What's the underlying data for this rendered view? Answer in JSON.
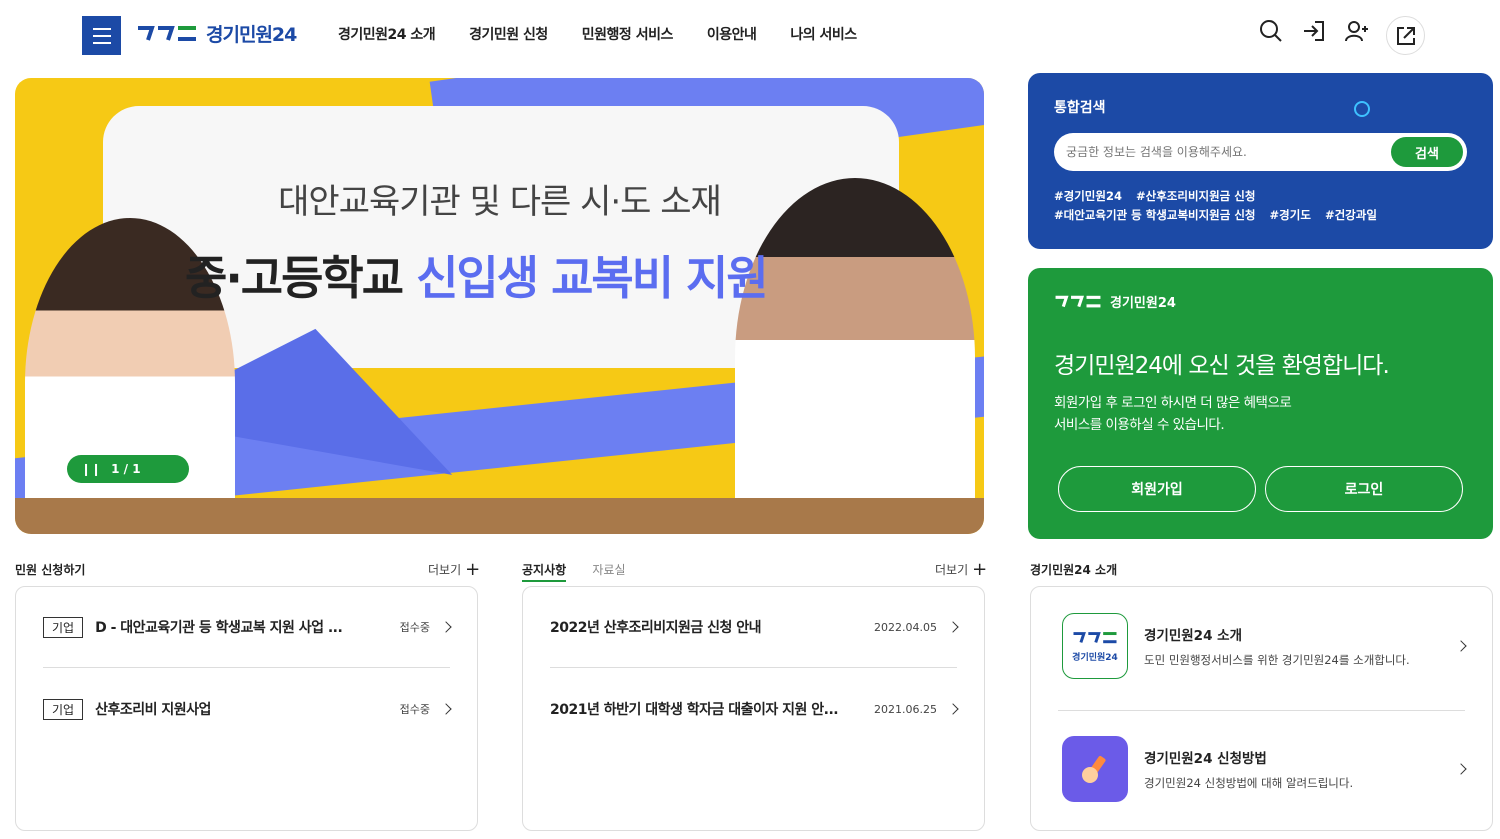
{
  "header": {
    "logo_text": "경기민원24",
    "nav": [
      "경기민원24 소개",
      "경기민원 신청",
      "민원행정 서비스",
      "이용안내",
      "나의 서비스"
    ]
  },
  "banner": {
    "line1": "대안교육기관 및 다른 시·도 소재",
    "line2_a": "중·고등학교",
    "line2_b": "신입생 교복비 지원",
    "pager": "1 / 1"
  },
  "search": {
    "title": "통합검색",
    "placeholder": "궁금한 정보는 검색을 이용해주세요.",
    "button": "검색",
    "tags": [
      "#경기민원24",
      "#산후조리비지원금 신청",
      "#대안교육기관 등 학생교복비지원금 신청",
      "#경기도",
      "#건강과일"
    ]
  },
  "welcome": {
    "logo_text": "경기민원24",
    "title": "경기민원24에 오신 것을 환영합니다.",
    "desc1": "회원가입 후 로그인 하시면 더 많은 혜택으로",
    "desc2": "서비스를 이용하실 수 있습니다.",
    "join": "회원가입",
    "login": "로그인"
  },
  "apply": {
    "title": "민원 신청하기",
    "more": "더보기",
    "items": [
      {
        "badge": "기업",
        "title": "D - 대안교육기관 등 학생교복 지원 사업 ...",
        "status": "접수중"
      },
      {
        "badge": "기업",
        "title": "산후조리비 지원사업",
        "status": "접수중"
      }
    ]
  },
  "notice": {
    "tab_active": "공지사항",
    "tab_inactive": "자료실",
    "more": "더보기",
    "items": [
      {
        "title": "2022년 산후조리비지원금 신청 안내",
        "date": "2022.04.05"
      },
      {
        "title": "2021년 하반기 대학생 학자금 대출이자 지원 안...",
        "date": "2021.06.25"
      }
    ]
  },
  "intro": {
    "title": "경기민원24 소개",
    "items": [
      {
        "title": "경기민원24 소개",
        "desc": "도민 민원행정서비스를 위한 경기민원24를 소개합니다.",
        "icon_text": "경기민원24"
      },
      {
        "title": "경기민원24 신청방법",
        "desc": "경기민원24 신청방법에 대해 알려드립니다."
      }
    ]
  },
  "colors": {
    "brand_blue": "#1c4aa6",
    "brand_green": "#1e9a3c",
    "banner_yellow": "#f6c915",
    "banner_purple": "#5b6df0"
  }
}
